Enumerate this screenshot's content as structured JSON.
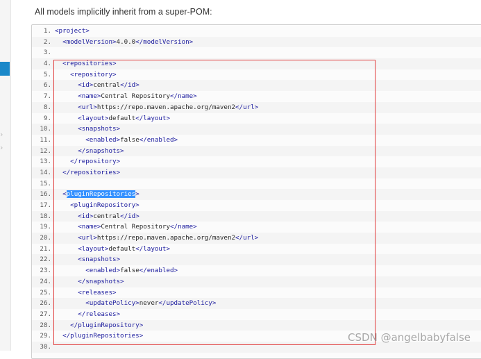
{
  "intro_text": "All models implicitly inherit from a super-POM:",
  "icons": {
    "rail_chevron": "chevron-right-icon"
  },
  "watermark": "CSDN @angelbabyfalse",
  "code": [
    {
      "n": "1.",
      "indent": "",
      "parts": [
        {
          "t": "tag",
          "v": "<project>"
        }
      ]
    },
    {
      "n": "2.",
      "indent": "  ",
      "parts": [
        {
          "t": "tag",
          "v": "<modelVersion>"
        },
        {
          "t": "txt",
          "v": "4.0.0"
        },
        {
          "t": "tag",
          "v": "</modelVersion>"
        }
      ]
    },
    {
      "n": "3.",
      "indent": "",
      "parts": []
    },
    {
      "n": "4.",
      "indent": "  ",
      "parts": [
        {
          "t": "tag",
          "v": "<repositories>"
        }
      ]
    },
    {
      "n": "5.",
      "indent": "    ",
      "parts": [
        {
          "t": "tag",
          "v": "<repository>"
        }
      ]
    },
    {
      "n": "6.",
      "indent": "      ",
      "parts": [
        {
          "t": "tag",
          "v": "<id>"
        },
        {
          "t": "txt",
          "v": "central"
        },
        {
          "t": "tag",
          "v": "</id>"
        }
      ]
    },
    {
      "n": "7.",
      "indent": "      ",
      "parts": [
        {
          "t": "tag",
          "v": "<name>"
        },
        {
          "t": "txt",
          "v": "Central Repository"
        },
        {
          "t": "tag",
          "v": "</name>"
        }
      ]
    },
    {
      "n": "8.",
      "indent": "      ",
      "parts": [
        {
          "t": "tag",
          "v": "<url>"
        },
        {
          "t": "txt",
          "v": "https://repo.maven.apache.org/maven2"
        },
        {
          "t": "tag",
          "v": "</url>"
        }
      ]
    },
    {
      "n": "9.",
      "indent": "      ",
      "parts": [
        {
          "t": "tag",
          "v": "<layout>"
        },
        {
          "t": "txt",
          "v": "default"
        },
        {
          "t": "tag",
          "v": "</layout>"
        }
      ]
    },
    {
      "n": "10.",
      "indent": "      ",
      "parts": [
        {
          "t": "tag",
          "v": "<snapshots>"
        }
      ]
    },
    {
      "n": "11.",
      "indent": "        ",
      "parts": [
        {
          "t": "tag",
          "v": "<enabled>"
        },
        {
          "t": "txt",
          "v": "false"
        },
        {
          "t": "tag",
          "v": "</enabled>"
        }
      ]
    },
    {
      "n": "12.",
      "indent": "      ",
      "parts": [
        {
          "t": "tag",
          "v": "</snapshots>"
        }
      ]
    },
    {
      "n": "13.",
      "indent": "    ",
      "parts": [
        {
          "t": "tag",
          "v": "</repository>"
        }
      ]
    },
    {
      "n": "14.",
      "indent": "  ",
      "parts": [
        {
          "t": "tag",
          "v": "</repositories>"
        }
      ]
    },
    {
      "n": "15.",
      "indent": "",
      "parts": []
    },
    {
      "n": "16.",
      "indent": "  ",
      "parts": [
        {
          "t": "tag",
          "v": "<"
        },
        {
          "t": "sel",
          "v": "pluginRepositories"
        },
        {
          "t": "tag",
          "v": ">"
        }
      ]
    },
    {
      "n": "17.",
      "indent": "    ",
      "parts": [
        {
          "t": "tag",
          "v": "<pluginRepository>"
        }
      ]
    },
    {
      "n": "18.",
      "indent": "      ",
      "parts": [
        {
          "t": "tag",
          "v": "<id>"
        },
        {
          "t": "txt",
          "v": "central"
        },
        {
          "t": "tag",
          "v": "</id>"
        }
      ]
    },
    {
      "n": "19.",
      "indent": "      ",
      "parts": [
        {
          "t": "tag",
          "v": "<name>"
        },
        {
          "t": "txt",
          "v": "Central Repository"
        },
        {
          "t": "tag",
          "v": "</name>"
        }
      ]
    },
    {
      "n": "20.",
      "indent": "      ",
      "parts": [
        {
          "t": "tag",
          "v": "<url>"
        },
        {
          "t": "txt",
          "v": "https://repo.maven.apache.org/maven2"
        },
        {
          "t": "tag",
          "v": "</url>"
        }
      ]
    },
    {
      "n": "21.",
      "indent": "      ",
      "parts": [
        {
          "t": "tag",
          "v": "<layout>"
        },
        {
          "t": "txt",
          "v": "default"
        },
        {
          "t": "tag",
          "v": "</layout>"
        }
      ]
    },
    {
      "n": "22.",
      "indent": "      ",
      "parts": [
        {
          "t": "tag",
          "v": "<snapshots>"
        }
      ]
    },
    {
      "n": "23.",
      "indent": "        ",
      "parts": [
        {
          "t": "tag",
          "v": "<enabled>"
        },
        {
          "t": "txt",
          "v": "false"
        },
        {
          "t": "tag",
          "v": "</enabled>"
        }
      ]
    },
    {
      "n": "24.",
      "indent": "      ",
      "parts": [
        {
          "t": "tag",
          "v": "</snapshots>"
        }
      ]
    },
    {
      "n": "25.",
      "indent": "      ",
      "parts": [
        {
          "t": "tag",
          "v": "<releases>"
        }
      ]
    },
    {
      "n": "26.",
      "indent": "        ",
      "parts": [
        {
          "t": "tag",
          "v": "<updatePolicy>"
        },
        {
          "t": "txt",
          "v": "never"
        },
        {
          "t": "tag",
          "v": "</updatePolicy>"
        }
      ]
    },
    {
      "n": "27.",
      "indent": "      ",
      "parts": [
        {
          "t": "tag",
          "v": "</releases>"
        }
      ]
    },
    {
      "n": "28.",
      "indent": "    ",
      "parts": [
        {
          "t": "tag",
          "v": "</pluginRepository>"
        }
      ]
    },
    {
      "n": "29.",
      "indent": "  ",
      "parts": [
        {
          "t": "tag",
          "v": "</pluginRepositories>"
        }
      ]
    },
    {
      "n": "30.",
      "indent": "",
      "parts": []
    }
  ]
}
